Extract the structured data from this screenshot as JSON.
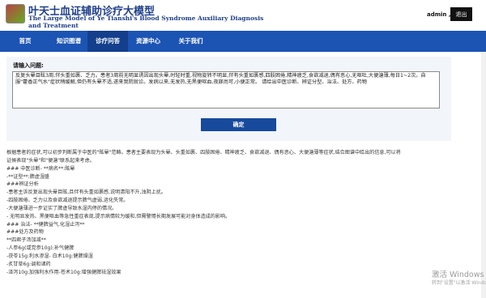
{
  "header": {
    "title_cn": "叶天士血证辅助诊疗大模型",
    "title_en": "The Large Model of Ye Tianshi's Blood Syndrome Auxiliary Diagnosis and Treatment",
    "user": "admin ,",
    "logout_label": "退出"
  },
  "nav": {
    "items": [
      "首页",
      "知识图谱",
      "诊疗问答",
      "资源中心",
      "关于我们"
    ],
    "active": "诊疗问答"
  },
  "query": {
    "label": "请输入问题:",
    "text": "反复头晕目眩3周,伴头重如裹、乏力。患者3周前无明显诱因出现头晕,时轻时重,视物旋转不明显,伴有头重如裹感,四肢困倦,精神疲乏,食欲减退,偶有恶心,无呕吐,大便溏薄,每日1~2次。自服\"藿香正气水\"症状稍缓解,但仍有头晕不适,遂来我院就诊。发病以来,无发热,无黑便呕血,夜寐尚可,小便正常。 请给出中医诊断、辨证分型、治法、处方、药物",
    "confirm_label": "确定"
  },
  "result": {
    "lines": [
      "根据患者的症状,可以初步判断属于中医的\"眩晕\"范畴。患者主要表现为头晕、头重如裹、四肢困倦、精神疲乏、食欲减退、偶有恶心、大便溏薄等症状,结合图谱中给出的信息,可以将",
      "证候表现\"头晕\"和\"便溏\"联系起来考虑。",
      "### 中医诊断- **病名**:眩晕",
      "-**证型**:脾虚湿盛",
      "###辨证分析",
      "-患者主诉反复出现头晕目眩,且伴有头重如裹感,说明清阳不升,浊阴上扰。",
      "-四肢困倦、乏力以及食欲减退提示脾气虚弱,运化失常。",
      "-大便溏薄进一步证实了脾虚导致水湿内停的情况。",
      "- 无明显发热、黑便呕血等急性重症表现,提示病情较为缓和,但需警惕长期发展可能对身体造成的影响。",
      "### 治法- **健脾益气,化湿止泻**",
      "###处方及药物",
      "**四君子汤加减**",
      "-人参6g(或党参10g):补气健脾",
      "-茯苓15g:利水渗湿- 白术10g:健脾燥湿",
      "-炙甘草6g:调和诸药",
      "-泽泻10g:加强利水作用-苍术10g:增强健脾祛湿效果"
    ]
  },
  "watermark": {
    "line1": "激活 Windows",
    "line2": "转到\"设置\"以激活 Windows。"
  }
}
